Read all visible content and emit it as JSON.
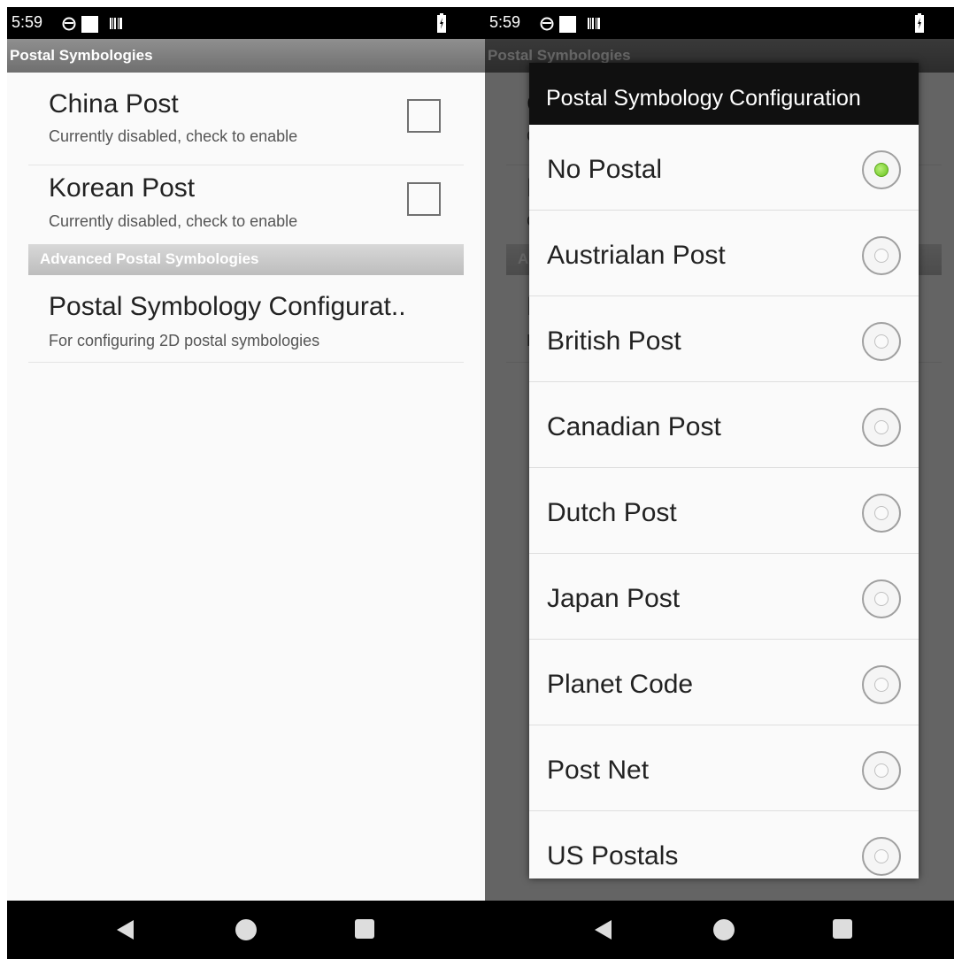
{
  "status_bar": {
    "time": "5:59"
  },
  "app_bar": {
    "title": "Postal Symbologies"
  },
  "preferences": [
    {
      "title": "China Post",
      "summary": "Currently disabled, check to enable",
      "checked": false
    },
    {
      "title": "Korean Post",
      "summary": "Currently disabled, check to enable",
      "checked": false
    }
  ],
  "advanced_category": {
    "label": "Advanced Postal Symbologies"
  },
  "config_pref": {
    "title": "Postal Symbology Configurat..",
    "summary": "For configuring 2D postal symbologies"
  },
  "dialog": {
    "title": "Postal Symbology Configuration",
    "selected": "No Postal",
    "options": [
      "No Postal",
      "Austrialan Post",
      "British Post",
      "Canadian Post",
      "Dutch Post",
      "Japan Post",
      "Planet Code",
      "Post Net",
      "US Postals"
    ]
  },
  "icons": {
    "status": [
      "sync-icon",
      "notification-square-icon",
      "barcode-icon",
      "battery-icon"
    ],
    "nav": [
      "back-icon",
      "home-icon",
      "recents-icon"
    ]
  },
  "colors": {
    "radio_selected": "#66c21a",
    "app_bar": "#7f7f7f",
    "status_bar": "#000000"
  }
}
